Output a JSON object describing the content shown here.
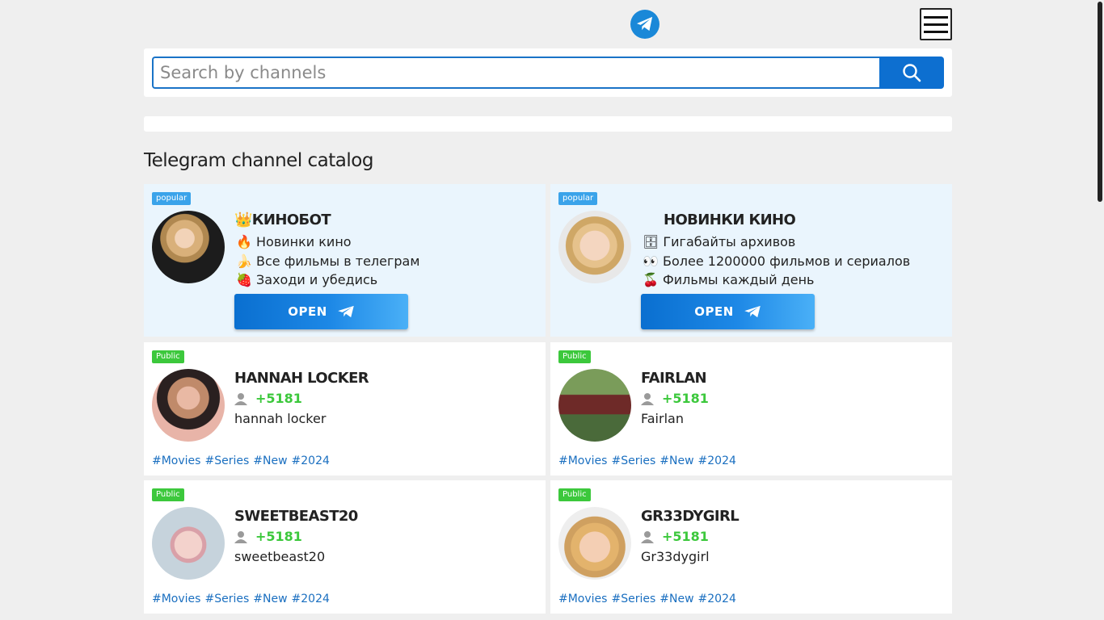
{
  "header": {
    "logo_icon": "telegram-plane-icon",
    "menu_icon": "hamburger-icon"
  },
  "search": {
    "placeholder": "Search by channels",
    "value": "",
    "button_icon": "magnifier-icon"
  },
  "page_title": "Telegram channel catalog",
  "popular_cards": [
    {
      "badge": "popular",
      "title": "👑КИНОБОТ",
      "lines": [
        "🔥 Новинки кино",
        "🍌 Все фильмы в телеграм",
        "🍓 Заходи и убедись"
      ],
      "open_label": "OPEN"
    },
    {
      "badge": "popular",
      "title": "НОВИНКИ КИНО",
      "lines": [
        "🗄 Гигабайты архивов",
        "👀 Более 1200000 фильмов и сериалов",
        "🍒 Фильмы каждый день"
      ],
      "open_label": "OPEN"
    }
  ],
  "public_cards": [
    {
      "badge": "Public",
      "title": "HANNAH LOCKER",
      "subs": "+5181",
      "handle": "hannah locker",
      "tags": [
        "#Movies",
        "#Series",
        "#New",
        "#2024"
      ]
    },
    {
      "badge": "Public",
      "title": "FAIRLAN",
      "subs": "+5181",
      "handle": "Fairlan",
      "tags": [
        "#Movies",
        "#Series",
        "#New",
        "#2024"
      ]
    },
    {
      "badge": "Public",
      "title": "SWEETBEAST20",
      "subs": "+5181",
      "handle": "sweetbeast20",
      "tags": [
        "#Movies",
        "#Series",
        "#New",
        "#2024"
      ]
    },
    {
      "badge": "Public",
      "title": "GR33DYGIRL",
      "subs": "+5181",
      "handle": "Gr33dygirl",
      "tags": [
        "#Movies",
        "#Series",
        "#New",
        "#2024"
      ]
    }
  ],
  "colors": {
    "accent": "#0d6fd0",
    "public_badge": "#3cc83c",
    "popular_badge": "#3aa3ea",
    "popular_bg": "#eaf5fd",
    "tag": "#1a6fc0"
  }
}
